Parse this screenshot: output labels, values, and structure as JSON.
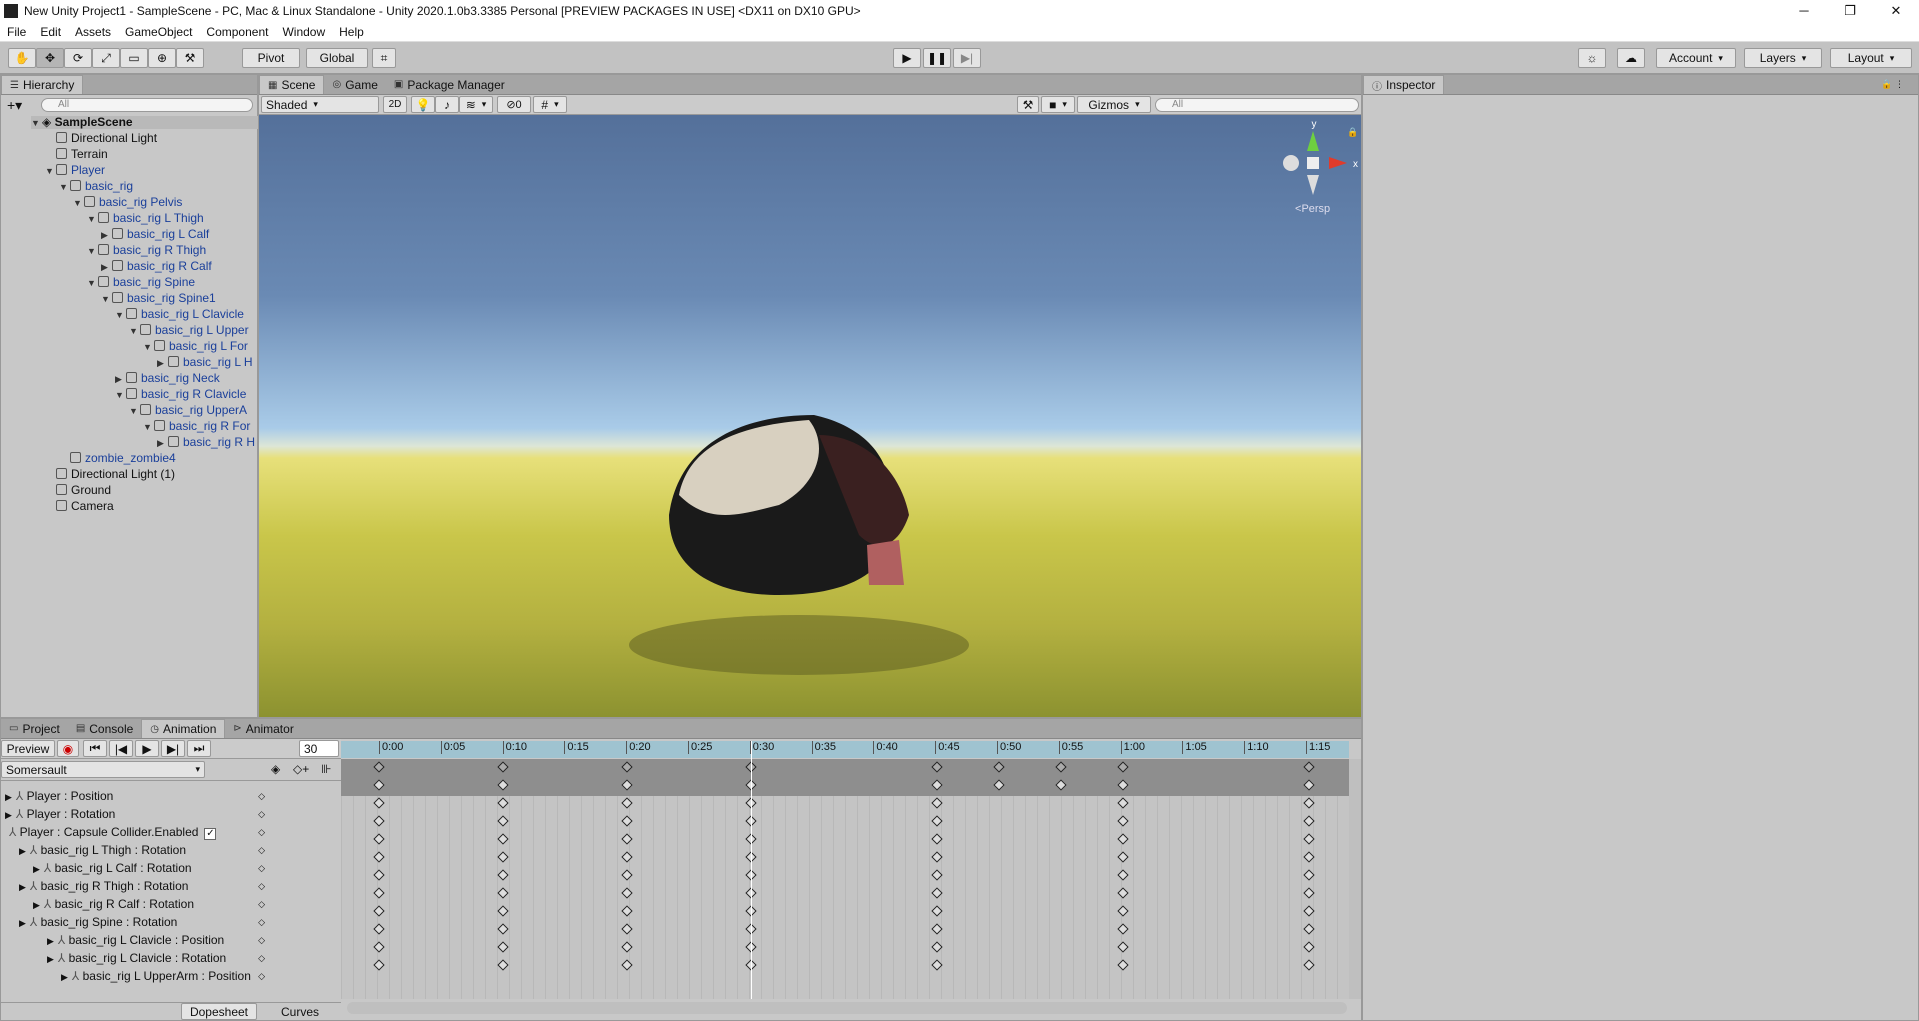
{
  "window": {
    "title": "New Unity Project1 - SampleScene - PC, Mac & Linux Standalone - Unity 2020.1.0b3.3385 Personal [PREVIEW PACKAGES IN USE] <DX11 on DX10 GPU>",
    "minimize": "─",
    "maximize": "❐",
    "close": "✕"
  },
  "menu": [
    "File",
    "Edit",
    "Assets",
    "GameObject",
    "Component",
    "Window",
    "Help"
  ],
  "toolbar": {
    "pivot": "Pivot",
    "global": "Global",
    "account": "Account",
    "layers": "Layers",
    "layout": "Layout"
  },
  "hierarchy": {
    "tab": "Hierarchy",
    "search_placeholder": "All",
    "scene": "SampleScene",
    "items": [
      {
        "label": "Directional Light",
        "depth": 1,
        "blue": false,
        "arrow": ""
      },
      {
        "label": "Terrain",
        "depth": 1,
        "blue": false,
        "arrow": ""
      },
      {
        "label": "Player",
        "depth": 1,
        "blue": true,
        "arrow": "▼"
      },
      {
        "label": "basic_rig",
        "depth": 2,
        "blue": true,
        "arrow": "▼"
      },
      {
        "label": "basic_rig Pelvis",
        "depth": 3,
        "blue": true,
        "arrow": "▼"
      },
      {
        "label": "basic_rig L Thigh",
        "depth": 4,
        "blue": true,
        "arrow": "▼"
      },
      {
        "label": "basic_rig L Calf",
        "depth": 5,
        "blue": true,
        "arrow": "▶"
      },
      {
        "label": "basic_rig R Thigh",
        "depth": 4,
        "blue": true,
        "arrow": "▼"
      },
      {
        "label": "basic_rig R Calf",
        "depth": 5,
        "blue": true,
        "arrow": "▶"
      },
      {
        "label": "basic_rig Spine",
        "depth": 4,
        "blue": true,
        "arrow": "▼"
      },
      {
        "label": "basic_rig Spine1",
        "depth": 5,
        "blue": true,
        "arrow": "▼"
      },
      {
        "label": "basic_rig L Clavicle",
        "depth": 6,
        "blue": true,
        "arrow": "▼"
      },
      {
        "label": "basic_rig L Upper",
        "depth": 7,
        "blue": true,
        "arrow": "▼"
      },
      {
        "label": "basic_rig L For",
        "depth": 8,
        "blue": true,
        "arrow": "▼"
      },
      {
        "label": "basic_rig L H",
        "depth": 9,
        "blue": true,
        "arrow": "▶"
      },
      {
        "label": "basic_rig Neck",
        "depth": 6,
        "blue": true,
        "arrow": "▶"
      },
      {
        "label": "basic_rig R Clavicle",
        "depth": 6,
        "blue": true,
        "arrow": "▼"
      },
      {
        "label": "basic_rig UpperA",
        "depth": 7,
        "blue": true,
        "arrow": "▼"
      },
      {
        "label": "basic_rig R For",
        "depth": 8,
        "blue": true,
        "arrow": "▼"
      },
      {
        "label": "basic_rig R H",
        "depth": 9,
        "blue": true,
        "arrow": "▶"
      },
      {
        "label": "zombie_zombie4",
        "depth": 2,
        "blue": true,
        "arrow": ""
      },
      {
        "label": "Directional Light (1)",
        "depth": 1,
        "blue": false,
        "arrow": ""
      },
      {
        "label": "Ground",
        "depth": 1,
        "blue": false,
        "arrow": ""
      },
      {
        "label": "Camera",
        "depth": 1,
        "blue": false,
        "arrow": ""
      }
    ]
  },
  "scene_tabs": {
    "scene": "Scene",
    "game": "Game",
    "package_manager": "Package Manager"
  },
  "scene_toolbar": {
    "shading": "Shaded",
    "mode_2d": "2D",
    "hidden_count": "0",
    "gizmos": "Gizmos",
    "search_placeholder": "All",
    "persp": "Persp",
    "axis_y": "y",
    "axis_x": "x"
  },
  "inspector": {
    "tab": "Inspector"
  },
  "bottom_tabs": {
    "project": "Project",
    "console": "Console",
    "animation": "Animation",
    "animator": "Animator"
  },
  "animation": {
    "preview": "Preview",
    "frame": "30",
    "clip": "Somersault",
    "time_labels": [
      "0:00",
      "0:05",
      "0:10",
      "0:15",
      "0:20",
      "0:25",
      "0:30",
      "0:35",
      "0:40",
      "0:45",
      "0:50",
      "0:55",
      "1:00",
      "1:05",
      "1:10",
      "1:15"
    ],
    "current_time": "0:30",
    "properties": [
      {
        "label": "Player : Position",
        "indent": 0,
        "arrow": "▶"
      },
      {
        "label": "Player : Rotation",
        "indent": 0,
        "arrow": "▶"
      },
      {
        "label": "Player : Capsule Collider.Enabled",
        "indent": 0,
        "arrow": "",
        "check": "✓"
      },
      {
        "label": "basic_rig L Thigh : Rotation",
        "indent": 1,
        "arrow": "▶"
      },
      {
        "label": "basic_rig L Calf : Rotation",
        "indent": 2,
        "arrow": "▶"
      },
      {
        "label": "basic_rig R Thigh : Rotation",
        "indent": 1,
        "arrow": "▶"
      },
      {
        "label": "basic_rig R Calf : Rotation",
        "indent": 2,
        "arrow": "▶"
      },
      {
        "label": "basic_rig Spine : Rotation",
        "indent": 1,
        "arrow": "▶"
      },
      {
        "label": "basic_rig L Clavicle : Position",
        "indent": 3,
        "arrow": "▶"
      },
      {
        "label": "basic_rig L Clavicle : Rotation",
        "indent": 3,
        "arrow": "▶"
      },
      {
        "label": "basic_rig L UpperArm : Position",
        "indent": 4,
        "arrow": "▶"
      }
    ],
    "dopesheet": "Dopesheet",
    "curves": "Curves"
  }
}
